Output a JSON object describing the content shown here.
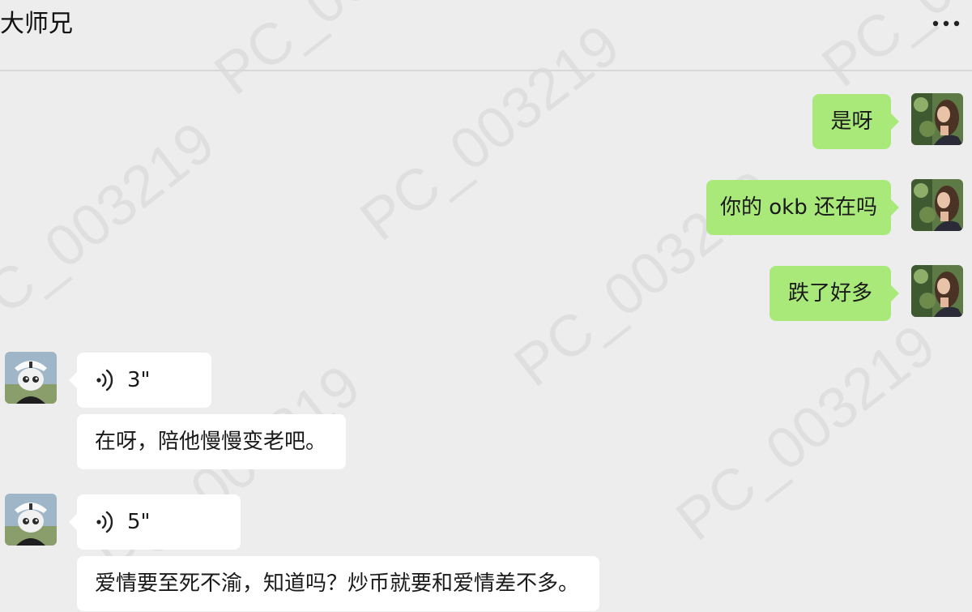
{
  "header": {
    "title": "大师兄",
    "more_icon": "more-horizontal-icon"
  },
  "watermark": {
    "text": "PC_003219"
  },
  "colors": {
    "background": "#ededed",
    "outgoing_bubble": "#a9e97a",
    "incoming_bubble": "#ffffff"
  },
  "messages": [
    {
      "sender": "self",
      "type": "text",
      "text": "是呀"
    },
    {
      "sender": "self",
      "type": "text",
      "text": "你的 okb 还在吗"
    },
    {
      "sender": "self",
      "type": "text",
      "text": "跌了好多"
    },
    {
      "sender": "contact",
      "type": "voice",
      "duration": "3\"",
      "icon": "voice-wave-icon"
    },
    {
      "sender": "contact",
      "type": "text",
      "text": "在呀，陪他慢慢变老吧。"
    },
    {
      "sender": "contact",
      "type": "voice",
      "duration": "5\"",
      "icon": "voice-wave-icon"
    },
    {
      "sender": "contact",
      "type": "text",
      "text": "爱情要至死不渝，知道吗？炒币就要和爱情差不多。"
    }
  ]
}
